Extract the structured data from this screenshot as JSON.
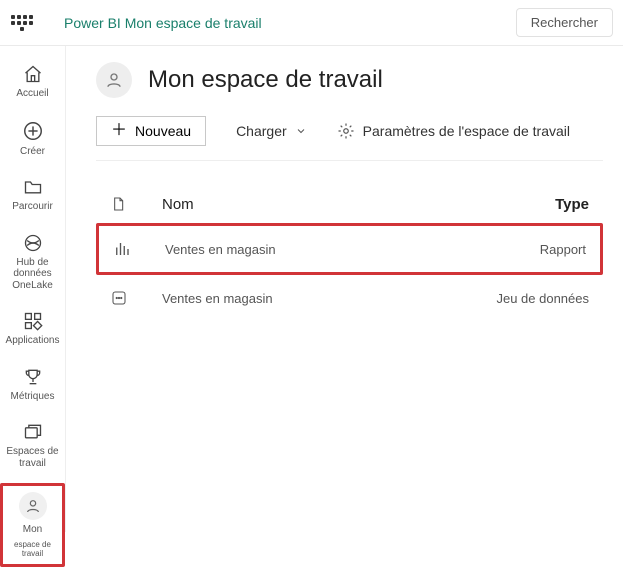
{
  "topbar": {
    "breadcrumb": "Power BI Mon espace de travail",
    "search_label": "Rechercher"
  },
  "nav": {
    "home": "Accueil",
    "create": "Créer",
    "browse": "Parcourir",
    "datahub": "Hub de données OneLake",
    "apps": "Applications",
    "metrics": "Métriques",
    "workspaces": "Espaces de travail",
    "my_workspace_line1": "Mon",
    "my_workspace_line2": "espace de travail"
  },
  "workspace": {
    "title": "Mon espace de travail"
  },
  "toolbar": {
    "new_label": "Nouveau",
    "upload_label": "Charger",
    "settings_label": "Paramètres de l'espace de travail"
  },
  "columns": {
    "name": "Nom",
    "type": "Type"
  },
  "rows": [
    {
      "name": "Ventes en magasin",
      "type": "Rapport",
      "kind": "report",
      "highlight": true
    },
    {
      "name": "Ventes en magasin",
      "type": "Jeu de données",
      "kind": "dataset",
      "highlight": false
    }
  ]
}
